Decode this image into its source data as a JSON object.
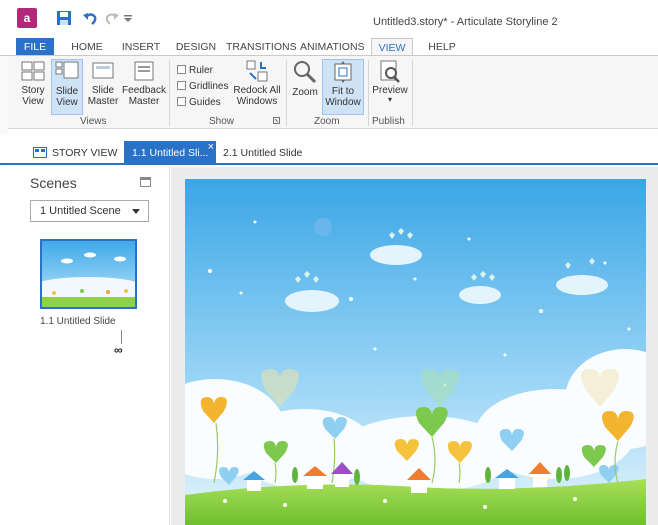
{
  "window": {
    "title": "Untitled3.story* - Articulate Storyline 2",
    "logo_text": "a"
  },
  "quick_access": {
    "save_icon": "save-icon",
    "undo_icon": "undo-icon",
    "redo_icon": "redo-icon",
    "more_icon": "customize-icon"
  },
  "ribbon_tabs": [
    "FILE",
    "HOME",
    "INSERT",
    "DESIGN",
    "TRANSITIONS",
    "ANIMATIONS",
    "VIEW",
    "HELP"
  ],
  "ribbon": {
    "views": {
      "label": "Views",
      "story_view": "Story View",
      "slide_view": "Slide View",
      "slide_master": "Slide Master",
      "feedback_master": "Feedback Master"
    },
    "show": {
      "label": "Show",
      "ruler": "Ruler",
      "gridlines": "Gridlines",
      "guides": "Guides",
      "redock": "Redock All Windows"
    },
    "zoom": {
      "label": "Zoom",
      "zoom": "Zoom",
      "fit": "Fit to Window"
    },
    "publish": {
      "label": "Publish",
      "preview": "Preview"
    }
  },
  "doc_tabs": {
    "story_view": "STORY VIEW",
    "active": "1.1 Untitled Sli...",
    "close": "×",
    "second": "2.1 Untitled Slide"
  },
  "scenes": {
    "title": "Scenes",
    "dropdown_value": "1 Untitled Scene",
    "slide_label": "1.1 Untitled Slide"
  },
  "colors": {
    "accent": "#2a71c8",
    "app_brand": "#b12a7a",
    "sky_top": "#4fb3ec",
    "grass": "#8fd14a"
  }
}
